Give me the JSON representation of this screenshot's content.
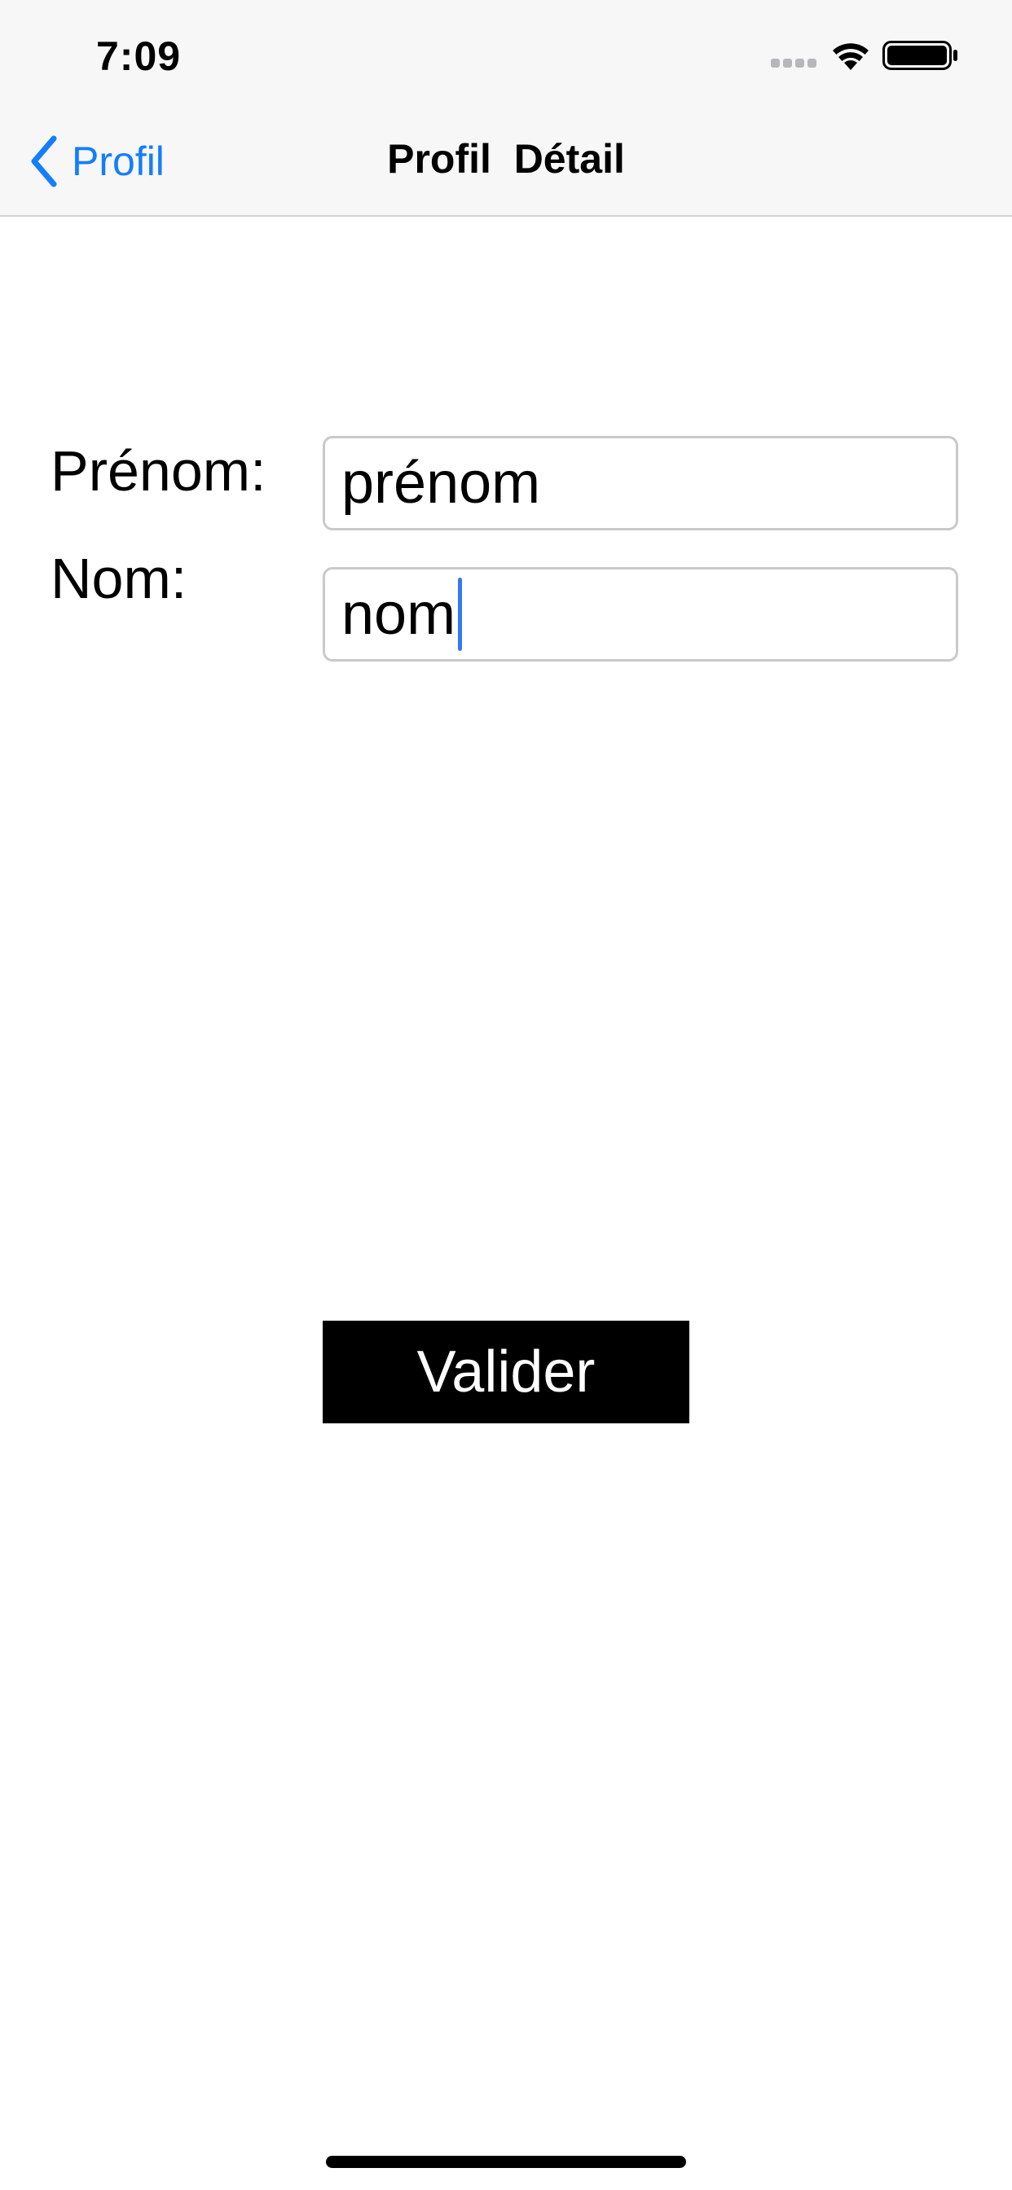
{
  "status_bar": {
    "time": "7:09",
    "icons": [
      "cellular-signal-icon",
      "wifi-icon",
      "battery-icon"
    ]
  },
  "nav_bar": {
    "back_label": "Profil",
    "back_icon": "chevron-left-icon",
    "title": "Profil  Détail"
  },
  "form": {
    "first_name": {
      "label": "Prénom:",
      "value": "prénom"
    },
    "last_name": {
      "label": "Nom:",
      "value": "nom"
    }
  },
  "submit_label": "Valider",
  "colors": {
    "accent": "#147efb",
    "caret": "#3478f6",
    "button_background": "#000000",
    "button_text": "#ffffff",
    "nav_background": "#f7f7f8"
  }
}
